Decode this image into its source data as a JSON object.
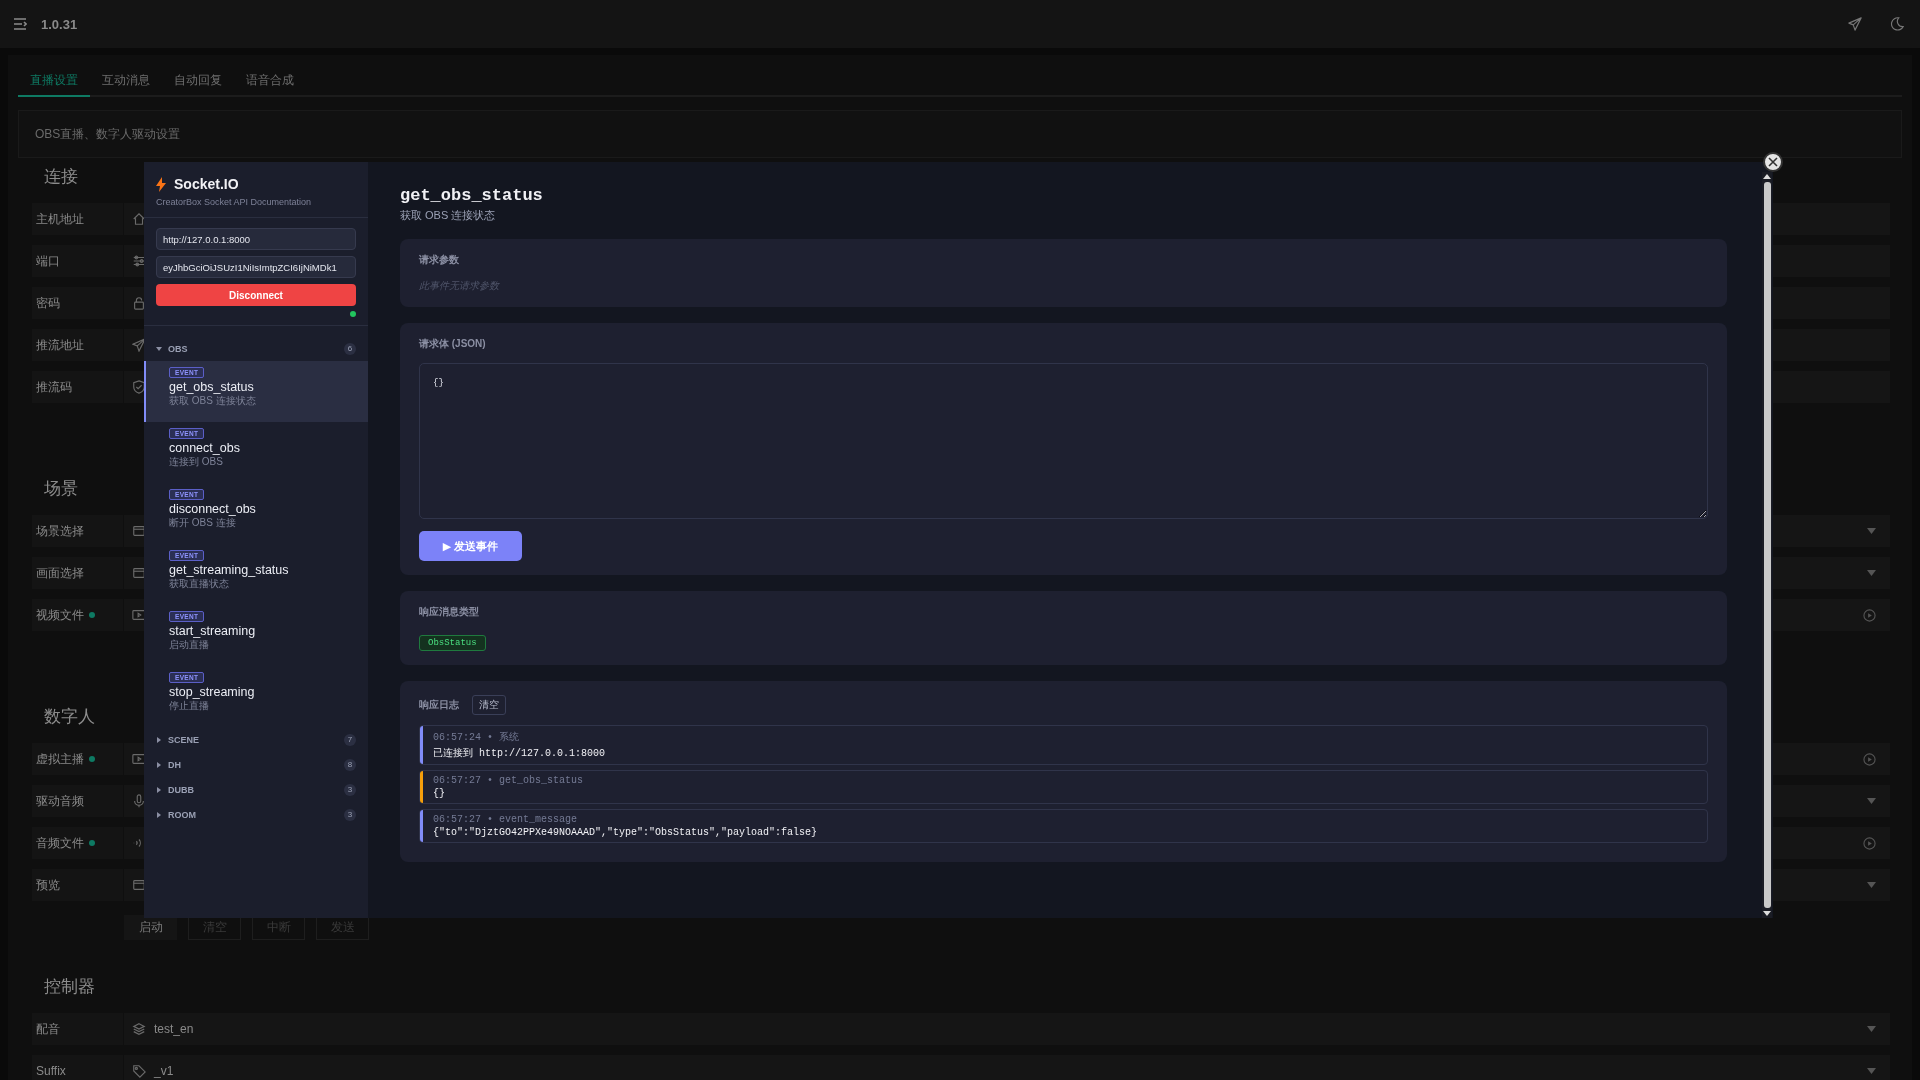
{
  "app": {
    "version": "1.0.31"
  },
  "tabs": [
    {
      "label": "直播设置",
      "selected": true
    },
    {
      "label": "互动消息",
      "selected": false
    },
    {
      "label": "自动回复",
      "selected": false
    },
    {
      "label": "语音合成",
      "selected": false
    }
  ],
  "description": "OBS直播、数字人驱动设置",
  "sections": [
    {
      "title": "连接",
      "rows": [
        {
          "label": "主机地址",
          "kind": "input",
          "dot": false
        },
        {
          "label": "端口",
          "kind": "input",
          "dot": false
        },
        {
          "label": "密码",
          "kind": "input",
          "dot": false
        },
        {
          "label": "推流地址",
          "kind": "input",
          "dot": false
        },
        {
          "label": "推流码",
          "kind": "input",
          "dot": false
        }
      ]
    },
    {
      "title": "场景",
      "rows": [
        {
          "label": "场景选择",
          "kind": "select",
          "dot": false
        },
        {
          "label": "画面选择",
          "kind": "select",
          "dot": false
        },
        {
          "label": "视频文件",
          "kind": "file",
          "dot": true
        }
      ]
    },
    {
      "title": "数字人",
      "rows": [
        {
          "label": "虚拟主播",
          "kind": "file",
          "dot": true
        },
        {
          "label": "驱动音频",
          "kind": "select",
          "dot": false
        },
        {
          "label": "音频文件",
          "kind": "file",
          "dot": true
        },
        {
          "label": "预览",
          "kind": "select",
          "dot": false
        }
      ],
      "buttons": [
        {
          "label": "启动",
          "kind": "primary"
        },
        {
          "label": "清空",
          "kind": "outline"
        },
        {
          "label": "中断",
          "kind": "outline"
        },
        {
          "label": "发送",
          "kind": "outline"
        }
      ]
    },
    {
      "title": "控制器",
      "rows": [
        {
          "label": "配音",
          "kind": "select",
          "value": "test_en"
        },
        {
          "label": "Suffix",
          "kind": "select",
          "value": "_v1"
        }
      ]
    }
  ],
  "modal": {
    "brand": {
      "name": "Socket.IO",
      "subtitle": "CreatorBox Socket API Documentation"
    },
    "connection": {
      "url": "http://127.0.0.1:8000",
      "token": "eyJhbGciOiJSUzI1NiIsImtpZCI6IjNiMDk1",
      "button": "Disconnect",
      "connected": true
    },
    "groups": [
      {
        "name": "OBS",
        "count": "6",
        "expanded": true,
        "events": [
          {
            "badge": "EVENT",
            "name": "get_obs_status",
            "desc": "获取 OBS 连接状态",
            "selected": true
          },
          {
            "badge": "EVENT",
            "name": "connect_obs",
            "desc": "连接到 OBS",
            "selected": false
          },
          {
            "badge": "EVENT",
            "name": "disconnect_obs",
            "desc": "断开 OBS 连接",
            "selected": false
          },
          {
            "badge": "EVENT",
            "name": "get_streaming_status",
            "desc": "获取直播状态",
            "selected": false
          },
          {
            "badge": "EVENT",
            "name": "start_streaming",
            "desc": "启动直播",
            "selected": false
          },
          {
            "badge": "EVENT",
            "name": "stop_streaming",
            "desc": "停止直播",
            "selected": false
          }
        ]
      },
      {
        "name": "SCENE",
        "count": "7",
        "expanded": false
      },
      {
        "name": "DH",
        "count": "8",
        "expanded": false
      },
      {
        "name": "DUBB",
        "count": "3",
        "expanded": false
      },
      {
        "name": "ROOM",
        "count": "3",
        "expanded": false
      }
    ],
    "detail": {
      "title": "get_obs_status",
      "desc": "获取 OBS 连接状态",
      "params": {
        "label": "请求参数",
        "empty_text": "此事件无请求参数"
      },
      "body": {
        "label": "请求体 (JSON)",
        "value": "{}",
        "send_button": "▶ 发送事件"
      },
      "response_type": {
        "label": "响应消息类型",
        "tag": "ObsStatus"
      },
      "log": {
        "label": "响应日志",
        "clear_button": "清空",
        "entries": [
          {
            "meta": "06:57:24 • 系统",
            "message": "已连接到 http://127.0.0.1:8000",
            "color": "#818cf8"
          },
          {
            "meta": "06:57:27 • get_obs_status",
            "message": "{}",
            "color": "#f59e0b"
          },
          {
            "meta": "06:57:27 • event_message",
            "message": "{\"to\":\"DjztGO42PPXe49NOAAAD\",\"type\":\"ObsStatus\",\"payload\":false}",
            "color": "#818cf8"
          }
        ]
      }
    }
  }
}
